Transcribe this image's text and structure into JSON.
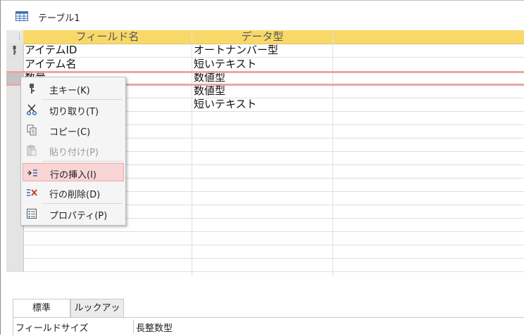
{
  "window": {
    "table_tab_title": "テーブル1",
    "table_icon": "table-icon"
  },
  "grid": {
    "columns": [
      "フィールド名",
      "データ型",
      ""
    ],
    "rows": [
      {
        "field": "アイテムID",
        "type": "オートナンバー型",
        "primary_key": true
      },
      {
        "field": "アイテム名",
        "type": "短いテキスト"
      },
      {
        "field": "数量",
        "type": "数値型"
      },
      {
        "field": "",
        "type": "数値型"
      },
      {
        "field": "",
        "type": "短いテキスト"
      }
    ]
  },
  "context_menu": {
    "items": [
      {
        "label": "主キー(K)",
        "icon": "primary-key-icon",
        "enabled": true
      },
      {
        "label": "切り取り(T)",
        "icon": "scissors-icon",
        "enabled": true
      },
      {
        "label": "コピー(C)",
        "icon": "copy-icon",
        "enabled": true
      },
      {
        "label": "貼り付け(P)",
        "icon": "paste-icon",
        "enabled": false
      },
      {
        "label": "行の挿入(I)",
        "icon": "insert-row-icon",
        "enabled": true,
        "highlighted": true
      },
      {
        "label": "行の削除(D)",
        "icon": "delete-row-icon",
        "enabled": true
      },
      {
        "label": "プロパティ(P)",
        "icon": "properties-icon",
        "enabled": true
      }
    ]
  },
  "properties": {
    "tabs": [
      "標準",
      "ルックアップ"
    ],
    "active_tab": "標準",
    "field_size_label": "フィールドサイズ",
    "field_size_value": "長整数型"
  },
  "colors": {
    "header_bg": "#f9d86a",
    "highlight_bg": "#f9d5d5",
    "insert_line": "#e9a7a7"
  }
}
